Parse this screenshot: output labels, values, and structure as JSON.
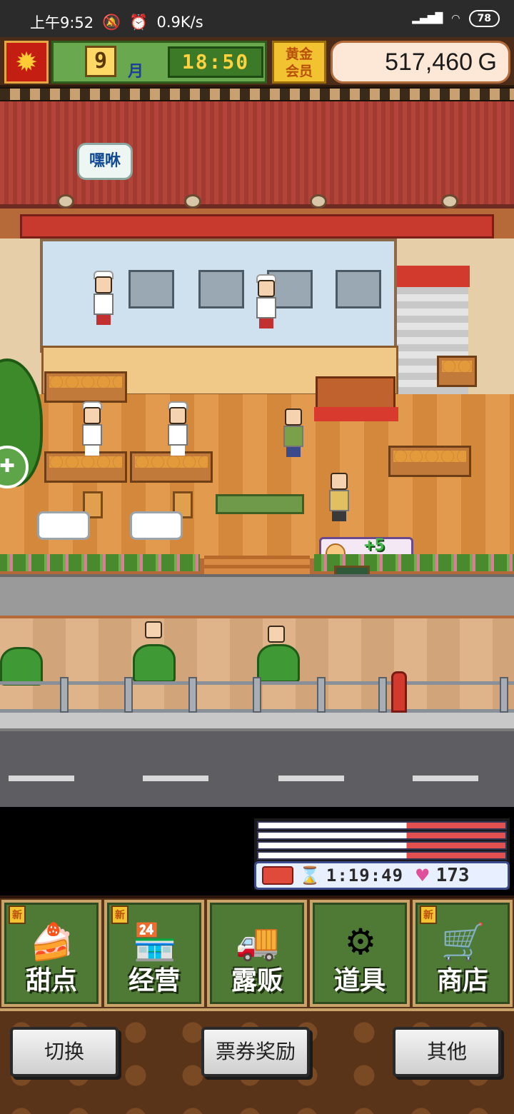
{
  "status_bar": {
    "time": "上午9:52",
    "speed": "0.9K/s",
    "battery": "78",
    "icons": [
      "mute-icon",
      "alarm-icon",
      "signal-icon",
      "wifi-icon",
      "battery-icon"
    ]
  },
  "hud": {
    "month": "9",
    "month_unit": "月",
    "clock": "18:50",
    "member_badge_line1": "黄金",
    "member_badge_line2": "会员",
    "money": "517,460",
    "money_unit": "G",
    "season_icon": "maple-leaf-icon"
  },
  "scene": {
    "speech_bubble": "嘿咻",
    "sale_popup_value": "+5"
  },
  "truck_status": {
    "timer": "1:19:49",
    "hearts": "173"
  },
  "menu": {
    "items": [
      {
        "label": "甜点",
        "icon": "cake-icon",
        "new": true,
        "new_label": "新"
      },
      {
        "label": "经营",
        "icon": "shop-icon",
        "new": true,
        "new_label": "新"
      },
      {
        "label": "露贩",
        "icon": "food-truck-icon",
        "new": false
      },
      {
        "label": "道具",
        "icon": "items-bag-icon",
        "new": false
      },
      {
        "label": "商店",
        "icon": "shopping-cart-icon",
        "new": true,
        "new_label": "新"
      }
    ]
  },
  "actions": {
    "switch_label": "切换",
    "voucher_label": "票券奖励",
    "other_label": "其他"
  },
  "colors": {
    "menu_green": "#4f7a35",
    "gold": "#f2c230",
    "awning_red": "#c8392e"
  }
}
